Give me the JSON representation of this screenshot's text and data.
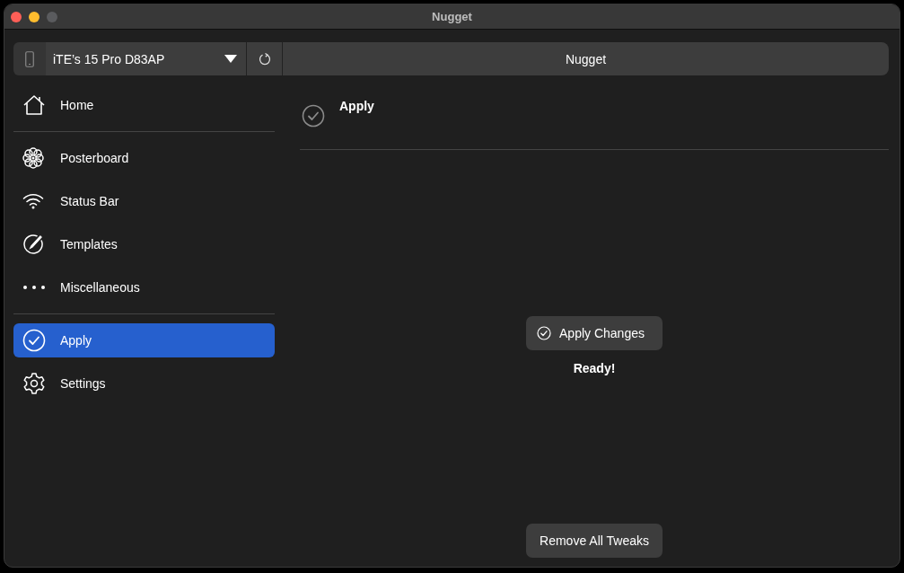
{
  "window": {
    "title": "Nugget"
  },
  "toolbar": {
    "device": "iTE’s 15 Pro D83AP",
    "title": "Nugget"
  },
  "sidebar": {
    "sections": [
      [
        {
          "label": "Home",
          "kind": "home",
          "selected": false
        }
      ],
      [
        {
          "label": "Posterboard",
          "kind": "posterboard",
          "selected": false
        },
        {
          "label": "Status Bar",
          "kind": "statusbar",
          "selected": false
        },
        {
          "label": "Templates",
          "kind": "templates",
          "selected": false
        },
        {
          "label": "Miscellaneous",
          "kind": "misc",
          "selected": false
        }
      ],
      [
        {
          "label": "Apply",
          "kind": "apply",
          "selected": true
        },
        {
          "label": "Settings",
          "kind": "settings",
          "selected": false
        }
      ]
    ]
  },
  "page": {
    "heading": "Apply",
    "apply_button": "Apply Changes",
    "status": "Ready!",
    "remove_button": "Remove All Tweaks"
  }
}
